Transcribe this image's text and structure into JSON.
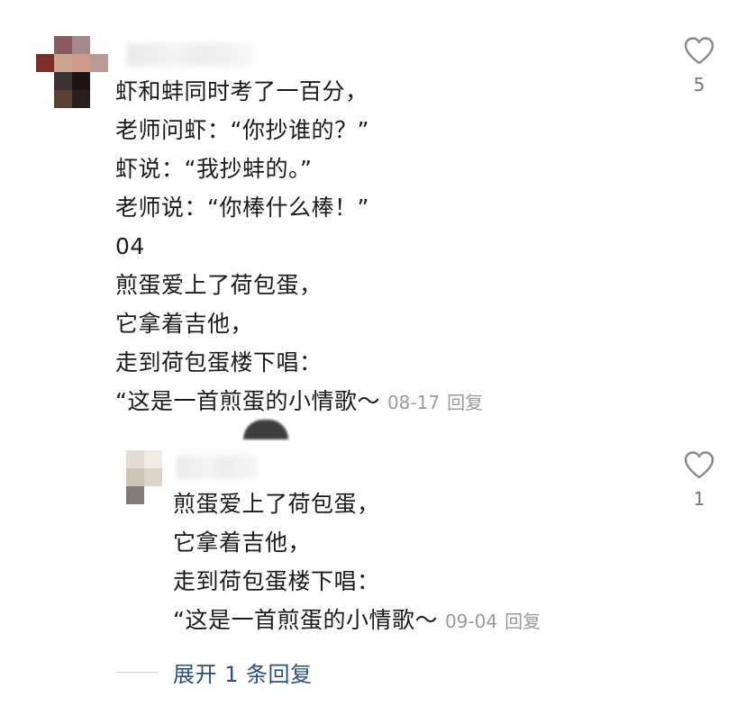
{
  "main_comment": {
    "avatar_colors": [
      "#ffffff",
      "#8a5a5e",
      "#a58a8b",
      "#ffffff",
      "#7d2c28",
      "#c9a490",
      "#cf9a8a",
      "#b89a96",
      "#ffffff",
      "#3a3234",
      "#1b1614",
      "#ffffff",
      "#ffffff",
      "#5c4030",
      "#2a1e1c",
      "#ffffff"
    ],
    "lines": [
      "虾和蚌同时考了一百分，",
      "老师问虾：“你抄谁的？”",
      "虾说：“我抄蚌的。”",
      "老师说：“你棒什么棒！”",
      "04",
      "煎蛋爱上了荷包蛋，",
      "它拿着吉他，",
      "走到荷包蛋楼下唱：",
      "“这是一首煎蛋的小情歌～"
    ],
    "date": "08-17",
    "reply_label": "回复",
    "like_count": "5"
  },
  "reply_comment": {
    "avatar_colors": [
      "#e2dcd4",
      "#f1ece6",
      "#cfc5b6",
      "#ddd5c9",
      "#7f7c78",
      "#ffffff"
    ],
    "lines": [
      "煎蛋爱上了荷包蛋，",
      "它拿着吉他，",
      "走到荷包蛋楼下唱：",
      "“这是一首煎蛋的小情歌～"
    ],
    "date": "09-04",
    "reply_label": "回复",
    "like_count": "1"
  },
  "expand_replies": {
    "label": "展开 1 条回复"
  },
  "icons": {
    "like": "heart-outline-icon"
  },
  "colors": {
    "text": "#1a1a1a",
    "meta": "#9a9a9a",
    "link": "#2b4f7e",
    "icon": "#888888"
  }
}
